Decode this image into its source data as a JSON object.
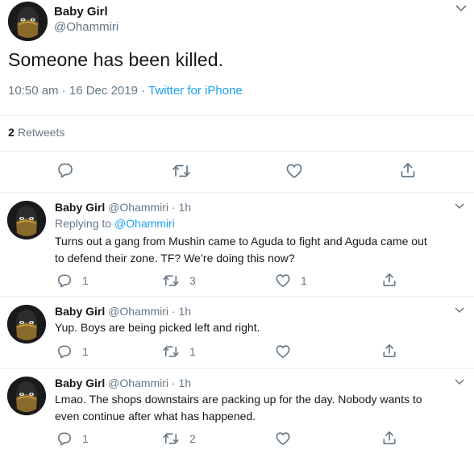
{
  "tweet": {
    "name": "Baby Girl",
    "handle": "@Ohammiri",
    "text": "Someone has been killed.",
    "time": "10:50 am · 16 Dec 2019 · ",
    "source": "Twitter for iPhone",
    "retweet_count": "2",
    "retweet_label": "Retweets",
    "icons": [
      "chevron-down-icon",
      "reply-icon",
      "retweet-icon",
      "like-icon",
      "share-icon"
    ]
  },
  "replies": [
    {
      "name": "Baby Girl",
      "handle": "@Ohammiri",
      "time": "1h",
      "replying_prefix": "Replying to ",
      "replying_to": "@Ohammiri",
      "lines": [
        "Turns out a gang from Mushin came to Aguda to fight and Aguda came out",
        "to defend their zone. TF? We’re doing this now?"
      ],
      "reply_count": "1",
      "retweet_count": "3",
      "like_count": "1"
    },
    {
      "name": "Baby Girl",
      "handle": "@Ohammiri",
      "time": "1h",
      "lines": [
        "Yup. Boys are being picked left and right."
      ],
      "reply_count": "1",
      "retweet_count": "1",
      "like_count": ""
    },
    {
      "name": "Baby Girl",
      "handle": "@Ohammiri",
      "time": "1h",
      "lines": [
        "Lmao. The shops downstairs are packing up for the day. Nobody wants to",
        "even continue after what has happened."
      ],
      "reply_count": "1",
      "retweet_count": "2",
      "like_count": ""
    }
  ],
  "colors": {
    "text": "#14171a",
    "secondary": "#657786",
    "link": "#1da1f2",
    "border": "#e6ecf0"
  }
}
